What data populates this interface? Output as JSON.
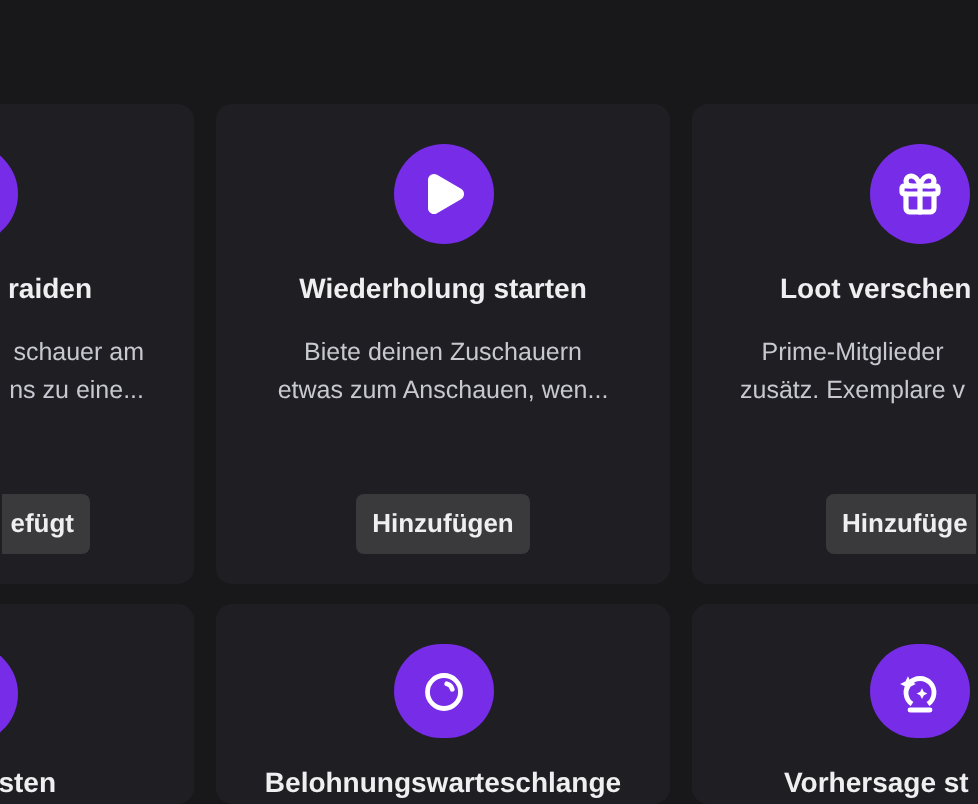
{
  "rows": [
    {
      "cards": [
        {
          "title": "raiden",
          "description_lines": [
            "schauer am",
            "ns zu eine..."
          ],
          "button": "efügt"
        },
        {
          "title": "Wiederholung starten",
          "description_lines": [
            "Biete deinen Zuschauern",
            "etwas zum Anschauen, wen..."
          ],
          "button": "Hinzufügen"
        },
        {
          "title": "Loot verschen",
          "description_lines": [
            "Prime-Mitglieder",
            "zusätz. Exemplare v"
          ],
          "button": "Hinzufüge"
        }
      ]
    },
    {
      "cards": [
        {
          "title": "sten"
        },
        {
          "title": "Belohnungswarteschlange"
        },
        {
          "title": "Vorhersage st"
        }
      ]
    }
  ]
}
